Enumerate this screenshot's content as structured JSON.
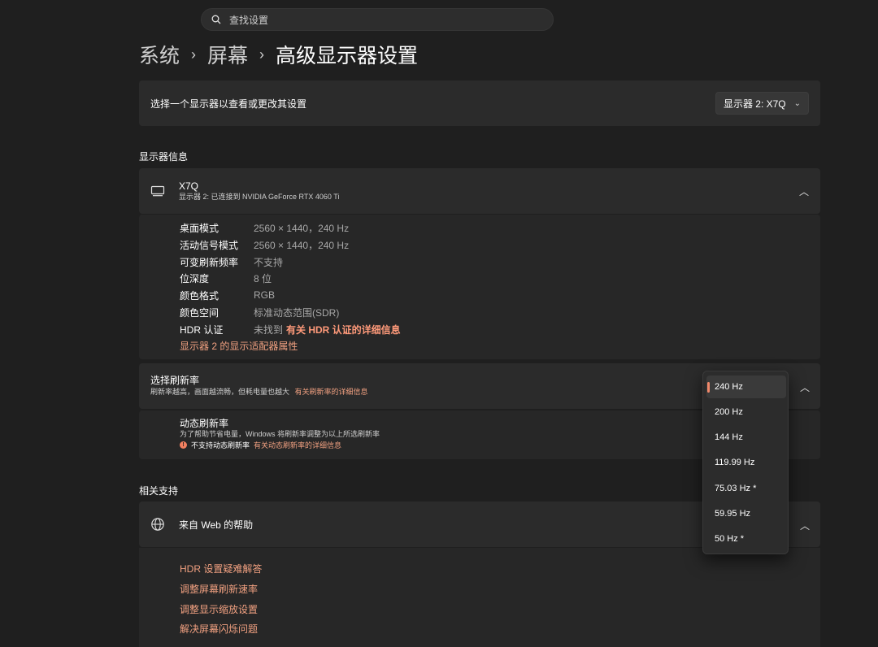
{
  "search": {
    "placeholder": "查找设置"
  },
  "breadcrumb": {
    "part1": "系统",
    "part2": "屏幕",
    "part3": "高级显示器设置",
    "sep": "›"
  },
  "select_display": {
    "label": "选择一个显示器以查看或更改其设置",
    "dropdown_value": "显示器 2: X7Q"
  },
  "display_info": {
    "section_title": "显示器信息",
    "name": "X7Q",
    "subtitle": "显示器 2: 已连接到 NVIDIA GeForce RTX 4060 Ti",
    "rows": [
      {
        "key": "桌面模式",
        "value": "2560 × 1440，240 Hz"
      },
      {
        "key": "活动信号模式",
        "value": "2560 × 1440，240 Hz"
      },
      {
        "key": "可变刷新频率",
        "value": "不支持"
      },
      {
        "key": "位深度",
        "value": "8 位"
      },
      {
        "key": "颜色格式",
        "value": "RGB"
      },
      {
        "key": "颜色空间",
        "value": "标准动态范围(SDR)"
      },
      {
        "key": "HDR 认证",
        "value": "未找到",
        "link": "有关 HDR 认证的详细信息"
      }
    ],
    "adapter_link": "显示器 2 的显示适配器属性"
  },
  "refresh": {
    "title": "选择刷新率",
    "subtitle": "刷新率越高，画面越流畅，但耗电量也越大",
    "link": "有关刷新率的详细信息",
    "options": [
      "240 Hz",
      "200 Hz",
      "144 Hz",
      "119.99 Hz",
      "75.03 Hz *",
      "59.95 Hz",
      "50 Hz *"
    ],
    "selected": "240 Hz"
  },
  "dynamic_refresh": {
    "title": "动态刷新率",
    "subtitle": "为了帮助节省电量，Windows 将刷新率调整为以上所选刷新率",
    "warning": "不支持动态刷新率",
    "link": "有关动态刷新率的详细信息"
  },
  "support": {
    "section_title": "相关支持",
    "help_title": "来自 Web 的帮助",
    "links": [
      "HDR 设置疑难解答",
      "调整屏幕刷新速率",
      "调整显示缩放设置",
      "解决屏幕闪烁问题"
    ]
  },
  "icons": {
    "search": "search-icon",
    "monitor": "monitor-icon",
    "globe": "globe-icon",
    "chevron": "chevron-icon"
  },
  "colors": {
    "accent": "#f0a080",
    "background": "#1f1f1f",
    "card": "#2b2b2b"
  }
}
